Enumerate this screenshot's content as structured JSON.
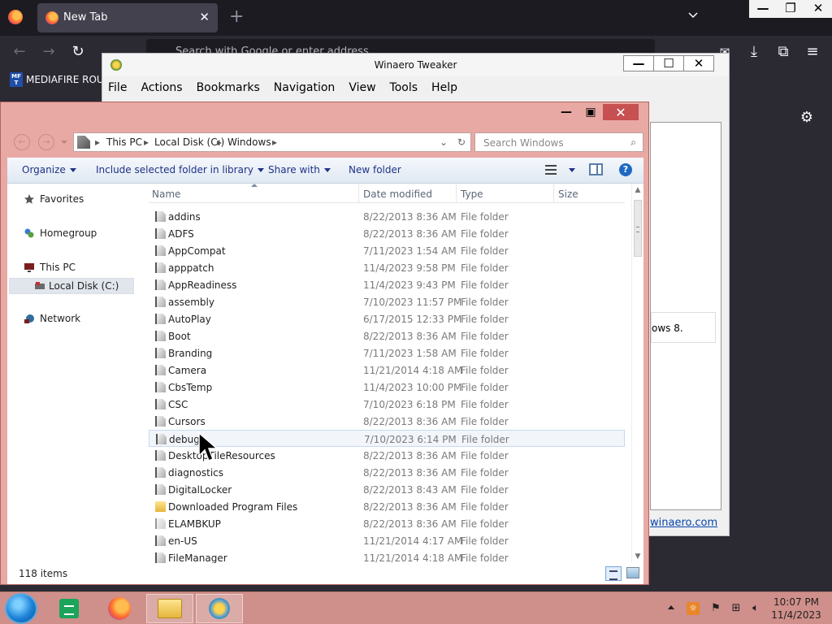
{
  "firefox": {
    "tab_title": "New Tab",
    "url_placeholder": "Search with Google or enter address",
    "bookmark_label": "MEDIAFIRE ROULETTE",
    "bookmark_icon_text": "MF T"
  },
  "tweaker": {
    "title": "Winaero Tweaker",
    "menu": [
      "File",
      "Actions",
      "Bookmarks",
      "Navigation",
      "View",
      "Tools",
      "Help"
    ],
    "note_text": "ows 8.",
    "link_text": "winaero.com"
  },
  "explorer": {
    "breadcrumb": [
      "This PC",
      "Local Disk (C:)",
      "Windows"
    ],
    "search_placeholder": "Search Windows",
    "toolbar": {
      "organize": "Organize",
      "include": "Include selected folder in library",
      "share": "Share with",
      "new_folder": "New folder"
    },
    "nav": {
      "favorites": "Favorites",
      "homegroup": "Homegroup",
      "this_pc": "This PC",
      "local_disk": "Local Disk (C:)",
      "network": "Network"
    },
    "columns": {
      "name": "Name",
      "date": "Date modified",
      "type": "Type",
      "size": "Size"
    },
    "rows": [
      {
        "name": "addins",
        "date": "8/22/2013 8:36 AM",
        "type": "File folder"
      },
      {
        "name": "ADFS",
        "date": "8/22/2013 8:36 AM",
        "type": "File folder"
      },
      {
        "name": "AppCompat",
        "date": "7/11/2023 1:54 AM",
        "type": "File folder"
      },
      {
        "name": "apppatch",
        "date": "11/4/2023 9:58 PM",
        "type": "File folder"
      },
      {
        "name": "AppReadiness",
        "date": "11/4/2023 9:43 PM",
        "type": "File folder"
      },
      {
        "name": "assembly",
        "date": "7/10/2023 11:57 PM",
        "type": "File folder"
      },
      {
        "name": "AutoPlay",
        "date": "6/17/2015 12:33 PM",
        "type": "File folder"
      },
      {
        "name": "Boot",
        "date": "8/22/2013 8:36 AM",
        "type": "File folder"
      },
      {
        "name": "Branding",
        "date": "7/11/2023 1:58 AM",
        "type": "File folder"
      },
      {
        "name": "Camera",
        "date": "11/21/2014 4:18 AM",
        "type": "File folder"
      },
      {
        "name": "CbsTemp",
        "date": "11/4/2023 10:00 PM",
        "type": "File folder"
      },
      {
        "name": "CSC",
        "date": "7/10/2023 6:18 PM",
        "type": "File folder"
      },
      {
        "name": "Cursors",
        "date": "8/22/2013 8:36 AM",
        "type": "File folder"
      },
      {
        "name": "debug",
        "date": "7/10/2023 6:14 PM",
        "type": "File folder"
      },
      {
        "name": "DesktopTileResources",
        "date": "8/22/2013 8:36 AM",
        "type": "File folder"
      },
      {
        "name": "diagnostics",
        "date": "8/22/2013 8:36 AM",
        "type": "File folder"
      },
      {
        "name": "DigitalLocker",
        "date": "8/22/2013 8:43 AM",
        "type": "File folder"
      },
      {
        "name": "Downloaded Program Files",
        "date": "8/22/2013 8:36 AM",
        "type": "File folder"
      },
      {
        "name": "ELAMBKUP",
        "date": "8/22/2013 8:36 AM",
        "type": "File folder"
      },
      {
        "name": "en-US",
        "date": "11/21/2014 4:17 AM",
        "type": "File folder"
      },
      {
        "name": "FileManager",
        "date": "11/21/2014 4:18 AM",
        "type": "File folder"
      }
    ],
    "status": "118 items"
  },
  "taskbar": {
    "time": "10:07 PM",
    "date": "11/4/2023"
  },
  "colors": {
    "explorer_frame": "#e8a9a4",
    "taskbar": "#cf8f8a",
    "firefox_dark": "#1c1b22",
    "close_red": "#c75050",
    "link_blue": "#0645ad"
  }
}
